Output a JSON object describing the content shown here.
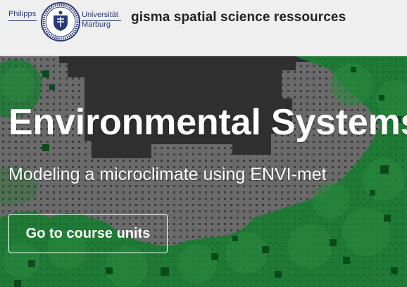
{
  "header": {
    "logo": {
      "left_text": "Philipps",
      "right_line1": "Universität",
      "right_line2": "Marburg"
    },
    "site_title": "gisma spatial science ressources"
  },
  "hero": {
    "title": "Environmental Systems",
    "subtitle": "Modeling a microclimate using ENVI-met",
    "cta_label": "Go to course units"
  },
  "colors": {
    "header_bg": "#efefef",
    "logo_blue": "#2a3a78",
    "building_dark": "#2f2f2f",
    "pavement_gray": "#6a6a6a",
    "vegetation_green": "#1f7a35",
    "vegetation_dark": "#0b4a1a",
    "text_white": "#ffffff"
  },
  "icons": {
    "seal": "university-seal-icon"
  }
}
